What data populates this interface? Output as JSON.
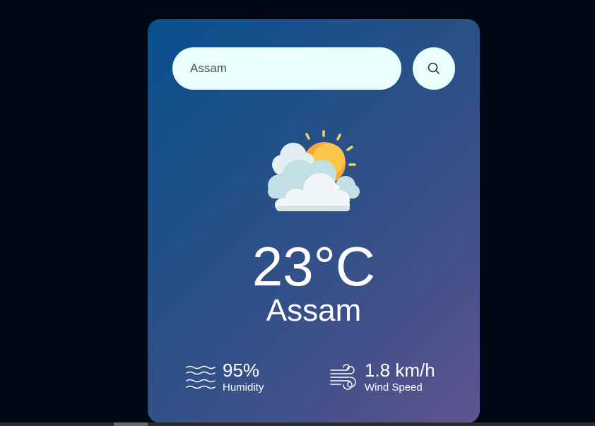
{
  "search": {
    "value": "Assam",
    "button_icon": "search-icon"
  },
  "weather": {
    "condition_icon": "partly-cloudy-icon",
    "temperature": "23°C",
    "city": "Assam"
  },
  "details": {
    "humidity": {
      "icon": "waves-icon",
      "value": "95%",
      "label": "Humidity"
    },
    "wind": {
      "icon": "wind-icon",
      "value": "1.8 km/h",
      "label": "Wind Speed"
    }
  },
  "colors": {
    "page_background": "#000712",
    "card_gradient_start": "#08508e",
    "card_gradient_end": "#5f558f",
    "input_background": "#eafffb",
    "text": "#ffffff"
  }
}
